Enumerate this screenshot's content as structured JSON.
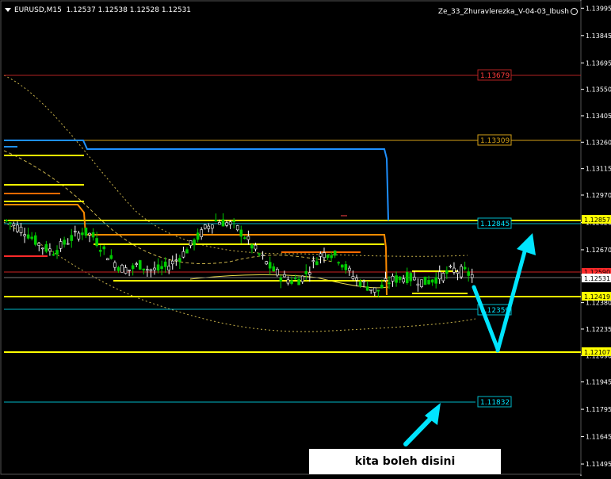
{
  "header": {
    "symbol": "EURUSD,M15",
    "ohlc": "1.12537 1.12538 1.12528 1.12531",
    "indicator": "Ze_33_Zhuravlerezka_V-04-03_Ibush"
  },
  "note": "kita boleh disini",
  "colors": {
    "background": "#000000",
    "bull": "#00cc00",
    "bear": "#ffffff",
    "yellow": "#ffff00",
    "orange": "#ff8c00",
    "blue": "#1e90ff",
    "cyan": "#00e5ff",
    "red": "#ff2a2a",
    "gold": "#d4a017"
  },
  "chart_data": {
    "type": "candlestick",
    "symbol": "EURUSD",
    "timeframe": "M15",
    "ylim": [
      1.1143,
      1.1404
    ],
    "y_ticks": [
      "1.13995",
      "1.13845",
      "1.13695",
      "1.13550",
      "1.13405",
      "1.13260",
      "1.13115",
      "1.12970",
      "1.12820",
      "1.12670",
      "1.12531",
      "1.12380",
      "1.12235",
      "1.12090",
      "1.11945",
      "1.11795",
      "1.11645",
      "1.11495"
    ],
    "price_labels": [
      {
        "value": "1.12857",
        "color": "yellow"
      },
      {
        "value": "1.12419",
        "color": "yellow"
      },
      {
        "value": "1.12107",
        "color": "yellow"
      },
      {
        "value": "1.12531",
        "color": "white"
      },
      {
        "value": "1.12590",
        "color": "red"
      }
    ],
    "level_labels": [
      {
        "value": "1.13679",
        "color": "red"
      },
      {
        "value": "1.13309",
        "color": "gold"
      },
      {
        "value": "1.12845",
        "color": "cyan"
      },
      {
        "value": "1.12359",
        "color": "cyan"
      },
      {
        "value": "1.11832",
        "color": "cyan"
      }
    ],
    "price_path": [
      1.1283,
      1.128,
      1.1277,
      1.1272,
      1.1268,
      1.1266,
      1.127,
      1.1274,
      1.1277,
      1.1275,
      1.1268,
      1.1262,
      1.1257,
      1.1256,
      1.1259,
      1.1256,
      1.1256,
      1.1258,
      1.1262,
      1.1267,
      1.1273,
      1.1279,
      1.1283,
      1.1282,
      1.128,
      1.1275,
      1.1268,
      1.1262,
      1.1256,
      1.1252,
      1.125,
      1.1251,
      1.1257,
      1.1264,
      1.1266,
      1.1262,
      1.1255,
      1.125,
      1.1247,
      1.1244,
      1.1249,
      1.1251,
      1.1252,
      1.1251,
      1.1249,
      1.1251,
      1.1253,
      1.1256,
      1.1255,
      1.1253
    ]
  }
}
